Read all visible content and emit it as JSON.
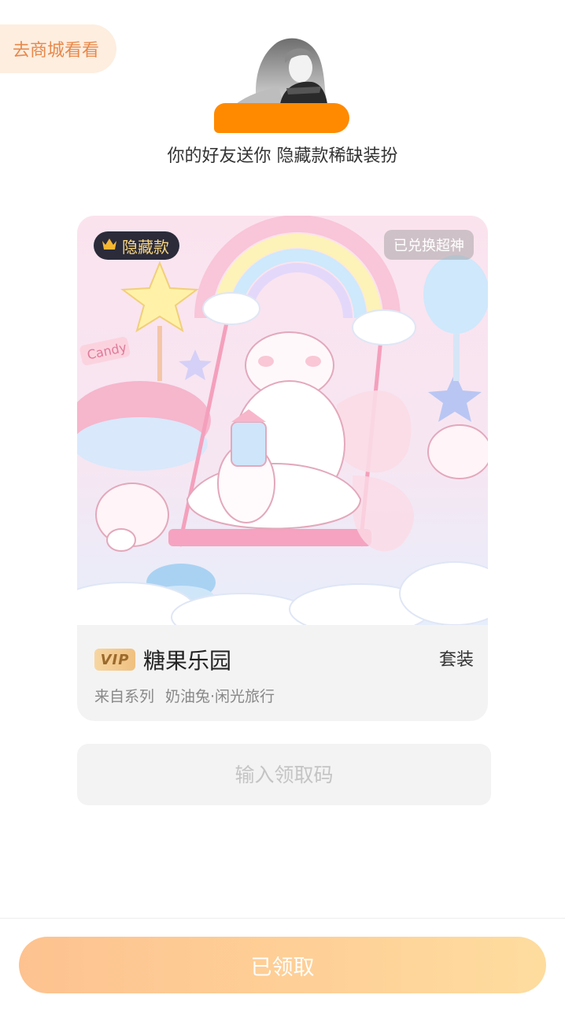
{
  "store_link": {
    "label": "去商城看看"
  },
  "gift": {
    "message": "你的好友送你 隐藏款稀缺装扮"
  },
  "card": {
    "hidden_tag": "隐藏款",
    "redeemed_tag": "已兑换超神",
    "artwork_text": "Candy",
    "vip_badge": "VIP",
    "title": "糖果乐园",
    "set_label": "套装",
    "series_prefix": "来自系列",
    "series_name": "奶油兔·闲光旅行"
  },
  "code_input": {
    "placeholder": "输入领取码"
  },
  "claim_button": {
    "label": "已领取"
  },
  "colors": {
    "accent_orange": "#ff8a00",
    "store_link_bg": "#fdeee0",
    "store_link_text": "#e8884a",
    "button_gradient_start": "#fdbd86",
    "button_gradient_end": "#fed996",
    "hidden_tag_text": "#f9d680"
  },
  "icons": {
    "crown": "crown-icon"
  }
}
